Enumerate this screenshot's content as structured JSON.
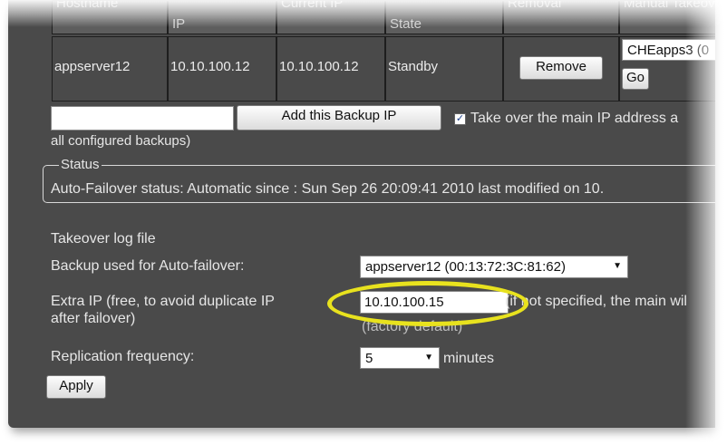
{
  "backups_table": {
    "headers": {
      "hostname": "Hostname",
      "ip": "IP",
      "current_ip": "Current IP",
      "state": "State",
      "removal": "Removal",
      "manual_takeover": "Manual Takeover"
    },
    "row": {
      "hostname": "appserver12",
      "ip": "10.10.100.12",
      "current_ip": "10.10.100.12",
      "state": "Standby",
      "remove_label": "Remove",
      "takeover_select_value": "CHEapps3 (0",
      "go_label": "Go"
    }
  },
  "add_backup": {
    "input_value": "",
    "button_label": "Add this Backup IP",
    "takeover_checkbox_checked": true,
    "takeover_label": "Take over the main IP address a",
    "continuation": "all configured backups)"
  },
  "status": {
    "legend": "Status",
    "text": "Auto-Failover status: Automatic since : Sun Sep 26 20:09:41 2010 last modified on 10."
  },
  "settings": {
    "takeover_log_label": "Takeover log file",
    "backup_used_label": "Backup used for Auto-failover:",
    "backup_used_value": "appserver12 (00:13:72:3C:81:62)",
    "extra_ip_label_line1": "Extra IP (free, to avoid duplicate IP",
    "extra_ip_label_line2": "after failover)",
    "extra_ip_value": "10.10.100.15",
    "extra_ip_note": "(if not specified, the main wil",
    "extra_ip_note2": "(factory default)",
    "replication_label": "Replication frequency:",
    "replication_value": "5",
    "replication_unit": "minutes",
    "apply_label": "Apply"
  },
  "colors": {
    "panel_bg": "#4a4a4a",
    "highlight_ring": "#e8e21e",
    "text": "#e6e6e6"
  }
}
